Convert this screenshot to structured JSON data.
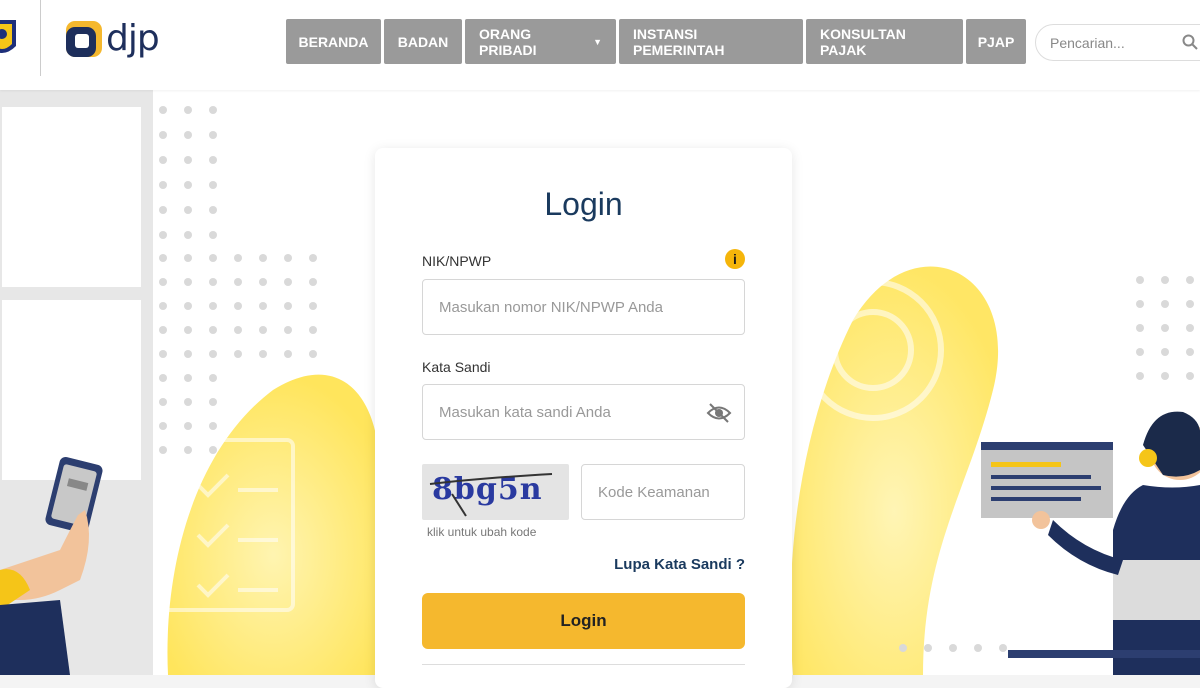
{
  "header": {
    "logo_text": "djp",
    "nav": [
      {
        "label": "BERANDA"
      },
      {
        "label": "BADAN"
      },
      {
        "label": "ORANG PRIBADI",
        "has_dropdown": true
      },
      {
        "label": "INSTANSI PEMERINTAH"
      },
      {
        "label": "KONSULTAN PAJAK"
      },
      {
        "label": "PJAP"
      }
    ],
    "search_placeholder": "Pencarian..."
  },
  "login": {
    "title": "Login",
    "nik_label": "NIK/NPWP",
    "nik_placeholder": "Masukan nomor NIK/NPWP Anda",
    "password_label": "Kata Sandi",
    "password_placeholder": "Masukan kata sandi Anda",
    "captcha_text": "8bg5n",
    "captcha_hint": "klik untuk ubah kode",
    "security_code_placeholder": "Kode Keamanan",
    "forgot_password": "Lupa Kata Sandi ?",
    "submit_label": "Login"
  },
  "colors": {
    "primary": "#1a3a5e",
    "accent": "#f5b82e",
    "nav_bg": "#9a9a9a"
  }
}
